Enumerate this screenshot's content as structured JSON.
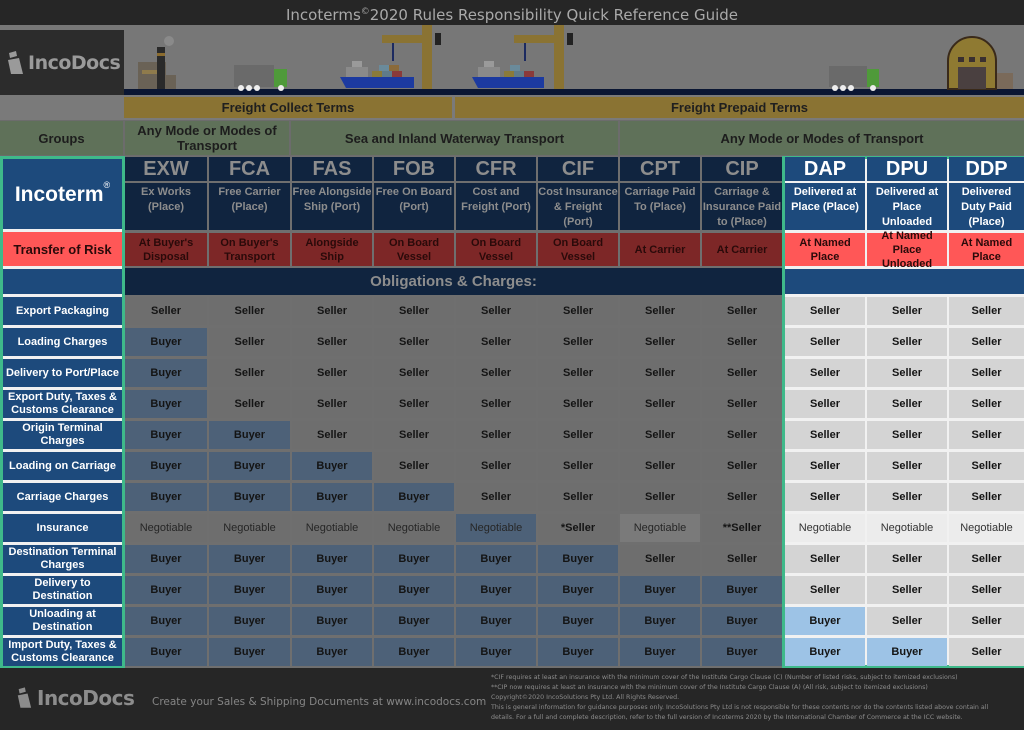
{
  "title": {
    "prefix": "Incoterms",
    "reg": "©",
    "suffix": "2020 Rules Responsibility Quick Reference Guide"
  },
  "brand": {
    "name": "IncoDocs"
  },
  "freight_terms": [
    {
      "label": "Freight Collect Terms"
    },
    {
      "label": "Freight Prepaid Terms"
    }
  ],
  "groups": {
    "label": "Groups",
    "items": [
      {
        "label": "Any Mode or Modes of Transport"
      },
      {
        "label": "Sea and Inland Waterway Transport"
      },
      {
        "label": "Any Mode or Modes of Transport"
      }
    ]
  },
  "labels": {
    "incoterm": "Incoterm",
    "incoterm_reg": "®",
    "transfer_of_risk": "Transfer of Risk",
    "obligations": "Obligations & Charges:"
  },
  "terms": [
    {
      "code": "EXW",
      "name": "Ex Works (Place)",
      "risk": "At Buyer's Disposal"
    },
    {
      "code": "FCA",
      "name": "Free Carrier (Place)",
      "risk": "On Buyer's Transport"
    },
    {
      "code": "FAS",
      "name": "Free Alongside Ship (Port)",
      "risk": "Alongside Ship"
    },
    {
      "code": "FOB",
      "name": "Free On Board (Port)",
      "risk": "On Board Vessel"
    },
    {
      "code": "CFR",
      "name": "Cost and Freight (Port)",
      "risk": "On Board Vessel"
    },
    {
      "code": "CIF",
      "name": "Cost Insurance & Freight (Port)",
      "risk": "On Board Vessel"
    },
    {
      "code": "CPT",
      "name": "Carriage Paid To (Place)",
      "risk": "At Carrier"
    },
    {
      "code": "CIP",
      "name": "Carriage & Insurance Paid to (Place)",
      "risk": "At Carrier"
    },
    {
      "code": "DAP",
      "name": "Delivered at Place (Place)",
      "risk": "At Named Place"
    },
    {
      "code": "DPU",
      "name": "Delivered at Place Unloaded (Place)",
      "risk": "At Named Place Unloaded"
    },
    {
      "code": "DDP",
      "name": "Delivered Duty Paid (Place)",
      "risk": "At Named Place"
    }
  ],
  "rows": [
    {
      "label": "Export Packaging",
      "values": [
        "Seller",
        "Seller",
        "Seller",
        "Seller",
        "Seller",
        "Seller",
        "Seller",
        "Seller",
        "Seller",
        "Seller",
        "Seller"
      ]
    },
    {
      "label": "Loading Charges",
      "values": [
        "Buyer",
        "Seller",
        "Seller",
        "Seller",
        "Seller",
        "Seller",
        "Seller",
        "Seller",
        "Seller",
        "Seller",
        "Seller"
      ]
    },
    {
      "label": "Delivery to Port/Place",
      "values": [
        "Buyer",
        "Seller",
        "Seller",
        "Seller",
        "Seller",
        "Seller",
        "Seller",
        "Seller",
        "Seller",
        "Seller",
        "Seller"
      ]
    },
    {
      "label": "Export Duty, Taxes & Customs Clearance",
      "values": [
        "Buyer",
        "Seller",
        "Seller",
        "Seller",
        "Seller",
        "Seller",
        "Seller",
        "Seller",
        "Seller",
        "Seller",
        "Seller"
      ]
    },
    {
      "label": "Origin Terminal Charges",
      "values": [
        "Buyer",
        "Buyer",
        "Seller",
        "Seller",
        "Seller",
        "Seller",
        "Seller",
        "Seller",
        "Seller",
        "Seller",
        "Seller"
      ]
    },
    {
      "label": "Loading on Carriage",
      "values": [
        "Buyer",
        "Buyer",
        "Buyer",
        "Seller",
        "Seller",
        "Seller",
        "Seller",
        "Seller",
        "Seller",
        "Seller",
        "Seller"
      ]
    },
    {
      "label": "Carriage Charges",
      "values": [
        "Buyer",
        "Buyer",
        "Buyer",
        "Buyer",
        "Seller",
        "Seller",
        "Seller",
        "Seller",
        "Seller",
        "Seller",
        "Seller"
      ]
    },
    {
      "label": "Insurance",
      "values": [
        "Negotiable",
        "Negotiable",
        "Negotiable",
        "Negotiable",
        "Negotiable",
        "*Seller",
        "Negotiable",
        "**Seller",
        "Negotiable",
        "Negotiable",
        "Negotiable"
      ]
    },
    {
      "label": "Destination Terminal Charges",
      "values": [
        "Buyer",
        "Buyer",
        "Buyer",
        "Buyer",
        "Buyer",
        "Buyer",
        "Seller",
        "Seller",
        "Seller",
        "Seller",
        "Seller"
      ]
    },
    {
      "label": "Delivery to Destination",
      "values": [
        "Buyer",
        "Buyer",
        "Buyer",
        "Buyer",
        "Buyer",
        "Buyer",
        "Buyer",
        "Buyer",
        "Seller",
        "Seller",
        "Seller"
      ]
    },
    {
      "label": "Unloading at Destination",
      "values": [
        "Buyer",
        "Buyer",
        "Buyer",
        "Buyer",
        "Buyer",
        "Buyer",
        "Buyer",
        "Buyer",
        "Buyer",
        "Seller",
        "Seller"
      ]
    },
    {
      "label": "Import Duty, Taxes & Customs Clearance",
      "values": [
        "Buyer",
        "Buyer",
        "Buyer",
        "Buyer",
        "Buyer",
        "Buyer",
        "Buyer",
        "Buyer",
        "Buyer",
        "Buyer",
        "Seller"
      ]
    }
  ],
  "footer": {
    "brand": "IncoDocs",
    "cta": "Create your Sales & Shipping Documents at www.incodocs.com",
    "notes": [
      "*CIF requires at least an insurance with the minimum cover of the Institute Cargo Clause (C) (Number of listed risks, subject to itemized exclusions)",
      "**CIP now requires at least an insurance with the minimum cover of the Institute Cargo Clause (A) (All risk, subject to itemized exclusions)",
      "Copyright©2020 IncoSolutions Pty Ltd. All Rights Reserved.",
      "This is general information for guidance purposes only.  IncoSolutions Pty Ltd is not responsible for these contents nor do the contents listed above contain all",
      "details.  For a full and complete description, refer to the full version of Incoterms   2020 by the International Chamber of Commerce at the ICC website."
    ]
  },
  "colors": {
    "accent_green": "#3fb98a",
    "navy": "#1d4a7c",
    "risk_red": "#ff5757",
    "buyer_blue": "#9dc3e6",
    "freight_gold": "#8a7333"
  }
}
